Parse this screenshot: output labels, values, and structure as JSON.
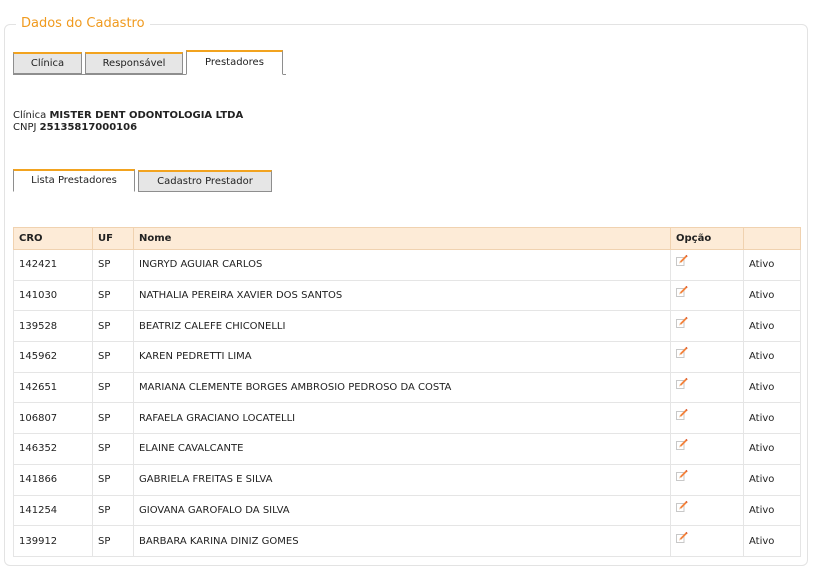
{
  "fieldset": {
    "legend": "Dados do Cadastro"
  },
  "tabs": [
    {
      "label": "Clínica",
      "active": false
    },
    {
      "label": "Responsável",
      "active": false
    },
    {
      "label": "Prestadores",
      "active": true
    }
  ],
  "clinic": {
    "name_label": "Clínica",
    "name": "MISTER DENT ODONTOLOGIA LTDA",
    "cnpj_label": "CNPJ",
    "cnpj": "25135817000106"
  },
  "sub_tabs": [
    {
      "label": "Lista Prestadores",
      "active": true
    },
    {
      "label": "Cadastro Prestador",
      "active": false
    }
  ],
  "table": {
    "headers": [
      "CRO",
      "UF",
      "Nome",
      "Opção",
      ""
    ],
    "edit_icon": "edit-icon",
    "rows": [
      {
        "cro": "142421",
        "uf": "SP",
        "nome": "INGRYD AGUIAR CARLOS",
        "status": "Ativo"
      },
      {
        "cro": "141030",
        "uf": "SP",
        "nome": "NATHALIA PEREIRA XAVIER DOS SANTOS",
        "status": "Ativo"
      },
      {
        "cro": "139528",
        "uf": "SP",
        "nome": "BEATRIZ CALEFE CHICONELLI",
        "status": "Ativo"
      },
      {
        "cro": "145962",
        "uf": "SP",
        "nome": "KAREN PEDRETTI LIMA",
        "status": "Ativo"
      },
      {
        "cro": "142651",
        "uf": "SP",
        "nome": "MARIANA CLEMENTE BORGES AMBROSIO PEDROSO DA COSTA",
        "status": "Ativo"
      },
      {
        "cro": "106807",
        "uf": "SP",
        "nome": "RAFAELA GRACIANO LOCATELLI",
        "status": "Ativo"
      },
      {
        "cro": "146352",
        "uf": "SP",
        "nome": "ELAINE CAVALCANTE",
        "status": "Ativo"
      },
      {
        "cro": "141866",
        "uf": "SP",
        "nome": "GABRIELA FREITAS E SILVA",
        "status": "Ativo"
      },
      {
        "cro": "141254",
        "uf": "SP",
        "nome": "GIOVANA GAROFALO DA SILVA",
        "status": "Ativo"
      },
      {
        "cro": "139912",
        "uf": "SP",
        "nome": "BARBARA KARINA DINIZ GOMES",
        "status": "Ativo"
      }
    ]
  },
  "colors": {
    "accent": "#f09a1e",
    "header_bg": "#fdebd7"
  }
}
